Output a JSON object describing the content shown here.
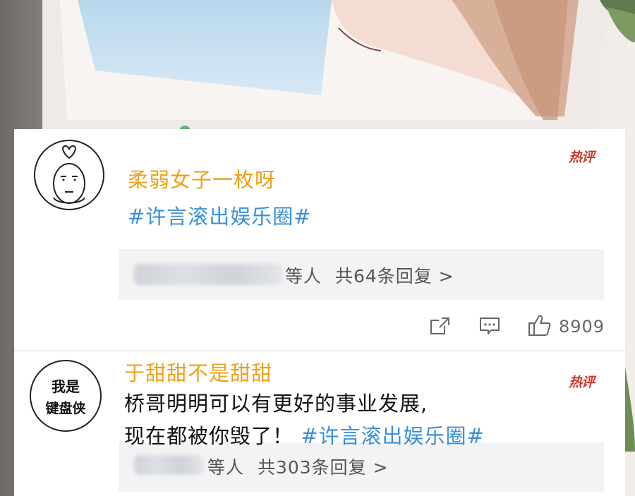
{
  "comments": [
    {
      "avatar_icon": "meme-face-avatar-icon",
      "username": "柔弱女子一枚呀",
      "badge": "热评",
      "text": "",
      "hashtag": "#许言滚出娱乐圈#",
      "replies": {
        "suffix_label": "等人",
        "count_text": "共64条回复 >"
      },
      "actions": {
        "share_icon": "share-icon",
        "comment_icon": "comment-icon",
        "like_icon": "thumbs-up-icon",
        "like_count": "8909"
      }
    },
    {
      "avatar_text_line1": "我是",
      "avatar_text_line2": "键盘侠",
      "username": "于甜甜不是甜甜",
      "badge": "热评",
      "text_line1": "桥哥明明可以有更好的事业发展,",
      "text_line2": "现在都被你毁了！",
      "hashtag": "#许言滚出娱乐圈#",
      "replies": {
        "suffix_label": "等人",
        "count_text": "共303条回复 >"
      }
    }
  ],
  "colors": {
    "username": "#f0a017",
    "hashtag": "#3a8fd8",
    "badge": "#d2362e",
    "reply_bg": "#f3f3f4"
  }
}
